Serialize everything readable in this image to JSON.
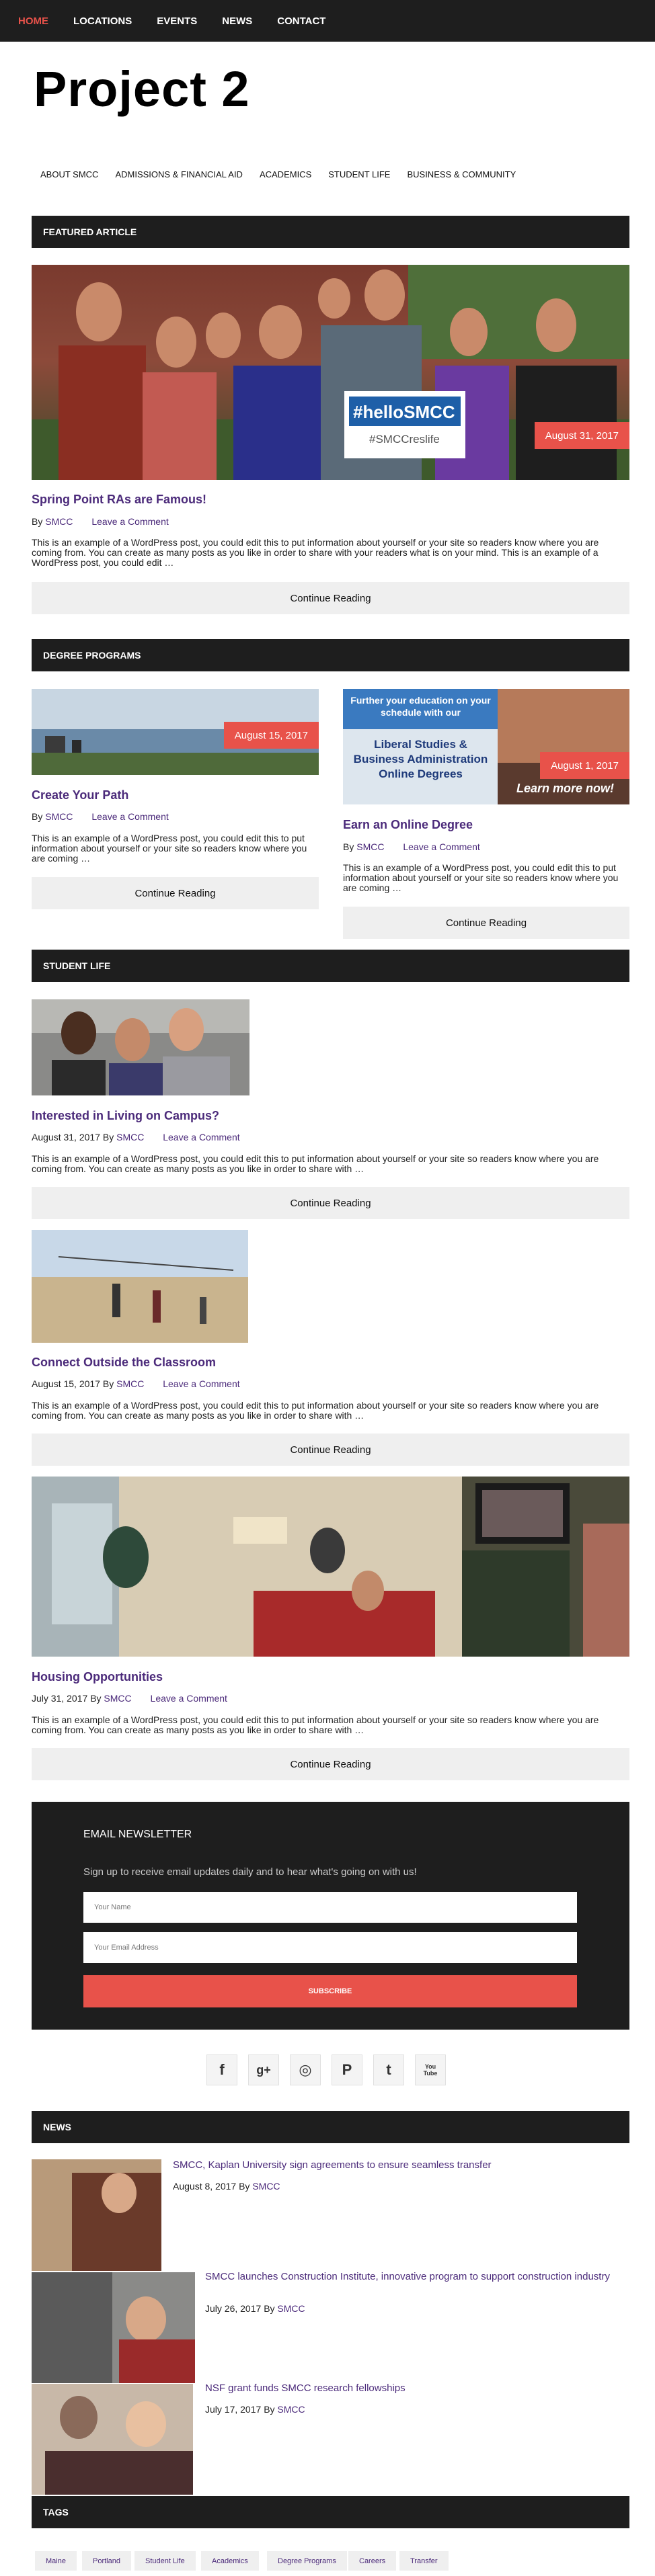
{
  "topnav": [
    "HOME",
    "LOCATIONS",
    "EVENTS",
    "NEWS",
    "CONTACT"
  ],
  "site_title": "Project 2",
  "subnav": [
    "ABOUT SMCC",
    "ADMISSIONS & FINANCIAL AID",
    "ACADEMICS",
    "STUDENT LIFE",
    "BUSINESS & COMMUNITY"
  ],
  "featured": {
    "heading": "FEATURED ARTICLE",
    "date": "August 31, 2017",
    "sign_main": "#helloSMCC",
    "sign_sub": "#SMCCreslife",
    "title": "Spring Point RAs are Famous!",
    "by": "By",
    "author": "SMCC",
    "comment": "Leave a Comment",
    "excerpt": "This is an example of a WordPress post, you could edit this to put information about yourself or your site so readers know where you are coming from. You can create as many posts as you like in order to share with your readers what is on your mind. This is an example of a WordPress post, you could edit …",
    "button": "Continue Reading"
  },
  "degree": {
    "heading": "DEGREE PROGRAMS",
    "left": {
      "date": "August 15, 2017",
      "title": "Create Your Path",
      "by": "By",
      "author": "SMCC",
      "comment": "Leave a Comment",
      "excerpt": "This is an example of a WordPress post, you could edit this to put information about yourself or your site so readers know where you are coming …",
      "button": "Continue Reading"
    },
    "right": {
      "date": "August 1, 2017",
      "ad_top": "Further your education on your schedule with our",
      "ad_main": "Liberal Studies & Business Administration Online Degrees",
      "ad_cta": "Learn more now!",
      "title": "Earn an Online Degree",
      "by": "By",
      "author": "SMCC",
      "comment": "Leave a Comment",
      "excerpt": "This is an example of a WordPress post, you could edit this to put information about yourself or your site so readers know where you are coming …",
      "button": "Continue Reading"
    }
  },
  "student_life": {
    "heading": "STUDENT LIFE",
    "posts": [
      {
        "title": "Interested in Living on Campus?",
        "date": "August 31, 2017",
        "by": "By",
        "author": "SMCC",
        "comment": "Leave a Comment",
        "excerpt": "This is an example of a WordPress post, you could edit this to put information about yourself or your site so readers know where you are coming from. You can create as many posts as you like in order to share with …",
        "button": "Continue Reading"
      },
      {
        "title": "Connect Outside the Classroom",
        "date": "August 15, 2017",
        "by": "By",
        "author": "SMCC",
        "comment": "Leave a Comment",
        "excerpt": "This is an example of a WordPress post, you could edit this to put information about yourself or your site so readers know where you are coming from. You can create as many posts as you like in order to share with …",
        "button": "Continue Reading"
      },
      {
        "title": "Housing Opportunities",
        "date": "July 31, 2017",
        "by": "By",
        "author": "SMCC",
        "comment": "Leave a Comment",
        "excerpt": "This is an example of a WordPress post, you could edit this to put information about yourself or your site so readers know where you are coming from. You can create as many posts as you like in order to share with …",
        "button": "Continue Reading"
      }
    ]
  },
  "newsletter": {
    "heading": "EMAIL NEWSLETTER",
    "text": "Sign up to receive email updates daily and to hear what's going on with us!",
    "name_placeholder": "Your Name",
    "email_placeholder": "Your Email Address",
    "button": "SUBSCRIBE"
  },
  "social_icons": [
    "facebook-icon",
    "google-plus-icon",
    "instagram-icon",
    "pinterest-icon",
    "twitter-icon",
    "youtube-icon"
  ],
  "social_glyphs": [
    "f",
    "g+",
    "◎",
    "P",
    "t",
    "You\nTube"
  ],
  "news": {
    "heading": "NEWS",
    "items": [
      {
        "title": "SMCC, Kaplan University sign agreements to ensure seamless transfer",
        "date": "August 8, 2017",
        "by": "By",
        "author": "SMCC"
      },
      {
        "title": "SMCC launches Construction Institute, innovative program to support construction industry",
        "date": "July 26, 2017",
        "by": "By",
        "author": "SMCC"
      },
      {
        "title": "NSF grant funds SMCC research fellowships",
        "date": "July 17, 2017",
        "by": "By",
        "author": "SMCC"
      }
    ]
  },
  "tags": {
    "heading": "TAGS",
    "items": [
      "Maine",
      "Portland",
      "Student Life",
      "Academics",
      "Degree Programs",
      "Careers",
      "Transfer"
    ]
  },
  "colors": {
    "accent": "#e8524a",
    "link": "#4b2a7a",
    "dark": "#1e1e1e"
  }
}
